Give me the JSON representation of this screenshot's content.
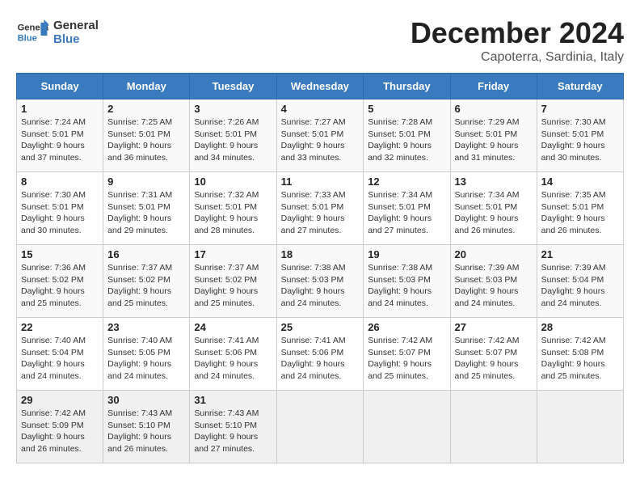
{
  "header": {
    "logo_line1": "General",
    "logo_line2": "Blue",
    "month": "December 2024",
    "location": "Capoterra, Sardinia, Italy"
  },
  "weekdays": [
    "Sunday",
    "Monday",
    "Tuesday",
    "Wednesday",
    "Thursday",
    "Friday",
    "Saturday"
  ],
  "weeks": [
    [
      {
        "day": 1,
        "info": "Sunrise: 7:24 AM\nSunset: 5:01 PM\nDaylight: 9 hours\nand 37 minutes."
      },
      {
        "day": 2,
        "info": "Sunrise: 7:25 AM\nSunset: 5:01 PM\nDaylight: 9 hours\nand 36 minutes."
      },
      {
        "day": 3,
        "info": "Sunrise: 7:26 AM\nSunset: 5:01 PM\nDaylight: 9 hours\nand 34 minutes."
      },
      {
        "day": 4,
        "info": "Sunrise: 7:27 AM\nSunset: 5:01 PM\nDaylight: 9 hours\nand 33 minutes."
      },
      {
        "day": 5,
        "info": "Sunrise: 7:28 AM\nSunset: 5:01 PM\nDaylight: 9 hours\nand 32 minutes."
      },
      {
        "day": 6,
        "info": "Sunrise: 7:29 AM\nSunset: 5:01 PM\nDaylight: 9 hours\nand 31 minutes."
      },
      {
        "day": 7,
        "info": "Sunrise: 7:30 AM\nSunset: 5:01 PM\nDaylight: 9 hours\nand 30 minutes."
      }
    ],
    [
      {
        "day": 8,
        "info": "Sunrise: 7:30 AM\nSunset: 5:01 PM\nDaylight: 9 hours\nand 30 minutes."
      },
      {
        "day": 9,
        "info": "Sunrise: 7:31 AM\nSunset: 5:01 PM\nDaylight: 9 hours\nand 29 minutes."
      },
      {
        "day": 10,
        "info": "Sunrise: 7:32 AM\nSunset: 5:01 PM\nDaylight: 9 hours\nand 28 minutes."
      },
      {
        "day": 11,
        "info": "Sunrise: 7:33 AM\nSunset: 5:01 PM\nDaylight: 9 hours\nand 27 minutes."
      },
      {
        "day": 12,
        "info": "Sunrise: 7:34 AM\nSunset: 5:01 PM\nDaylight: 9 hours\nand 27 minutes."
      },
      {
        "day": 13,
        "info": "Sunrise: 7:34 AM\nSunset: 5:01 PM\nDaylight: 9 hours\nand 26 minutes."
      },
      {
        "day": 14,
        "info": "Sunrise: 7:35 AM\nSunset: 5:01 PM\nDaylight: 9 hours\nand 26 minutes."
      }
    ],
    [
      {
        "day": 15,
        "info": "Sunrise: 7:36 AM\nSunset: 5:02 PM\nDaylight: 9 hours\nand 25 minutes."
      },
      {
        "day": 16,
        "info": "Sunrise: 7:37 AM\nSunset: 5:02 PM\nDaylight: 9 hours\nand 25 minutes."
      },
      {
        "day": 17,
        "info": "Sunrise: 7:37 AM\nSunset: 5:02 PM\nDaylight: 9 hours\nand 25 minutes."
      },
      {
        "day": 18,
        "info": "Sunrise: 7:38 AM\nSunset: 5:03 PM\nDaylight: 9 hours\nand 24 minutes."
      },
      {
        "day": 19,
        "info": "Sunrise: 7:38 AM\nSunset: 5:03 PM\nDaylight: 9 hours\nand 24 minutes."
      },
      {
        "day": 20,
        "info": "Sunrise: 7:39 AM\nSunset: 5:03 PM\nDaylight: 9 hours\nand 24 minutes."
      },
      {
        "day": 21,
        "info": "Sunrise: 7:39 AM\nSunset: 5:04 PM\nDaylight: 9 hours\nand 24 minutes."
      }
    ],
    [
      {
        "day": 22,
        "info": "Sunrise: 7:40 AM\nSunset: 5:04 PM\nDaylight: 9 hours\nand 24 minutes."
      },
      {
        "day": 23,
        "info": "Sunrise: 7:40 AM\nSunset: 5:05 PM\nDaylight: 9 hours\nand 24 minutes."
      },
      {
        "day": 24,
        "info": "Sunrise: 7:41 AM\nSunset: 5:06 PM\nDaylight: 9 hours\nand 24 minutes."
      },
      {
        "day": 25,
        "info": "Sunrise: 7:41 AM\nSunset: 5:06 PM\nDaylight: 9 hours\nand 24 minutes."
      },
      {
        "day": 26,
        "info": "Sunrise: 7:42 AM\nSunset: 5:07 PM\nDaylight: 9 hours\nand 25 minutes."
      },
      {
        "day": 27,
        "info": "Sunrise: 7:42 AM\nSunset: 5:07 PM\nDaylight: 9 hours\nand 25 minutes."
      },
      {
        "day": 28,
        "info": "Sunrise: 7:42 AM\nSunset: 5:08 PM\nDaylight: 9 hours\nand 25 minutes."
      }
    ],
    [
      {
        "day": 29,
        "info": "Sunrise: 7:42 AM\nSunset: 5:09 PM\nDaylight: 9 hours\nand 26 minutes."
      },
      {
        "day": 30,
        "info": "Sunrise: 7:43 AM\nSunset: 5:10 PM\nDaylight: 9 hours\nand 26 minutes."
      },
      {
        "day": 31,
        "info": "Sunrise: 7:43 AM\nSunset: 5:10 PM\nDaylight: 9 hours\nand 27 minutes."
      },
      null,
      null,
      null,
      null
    ]
  ]
}
